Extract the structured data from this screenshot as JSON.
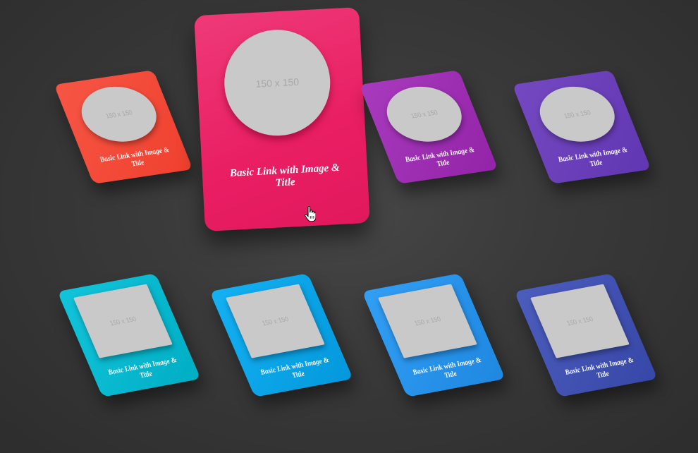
{
  "cards": [
    {
      "thumb": "150 x 150",
      "title": "Basic Link with Image & Title",
      "color": "#f44336"
    },
    {
      "thumb": "150 x 150",
      "title": "Basic Link with Image & Title",
      "color": "#e91e63"
    },
    {
      "thumb": "150 x 150",
      "title": "Basic Link with Image & Title",
      "color": "#9c27b0"
    },
    {
      "thumb": "150 x 150",
      "title": "Basic Link with Image & Title",
      "color": "#673ab7"
    },
    {
      "thumb": "150 x 150",
      "title": "Basic Link with Image & Title",
      "color": "#00bcd4"
    },
    {
      "thumb": "150 x 150",
      "title": "Basic Link with Image & Title",
      "color": "#03a9f4"
    },
    {
      "thumb": "150 x 150",
      "title": "Basic Link with Image & Title",
      "color": "#2196f3"
    },
    {
      "thumb": "150 x 150",
      "title": "Basic Link with Image & Title",
      "color": "#3f51b5"
    }
  ],
  "cursor_icon": "hand-pointer-icon"
}
